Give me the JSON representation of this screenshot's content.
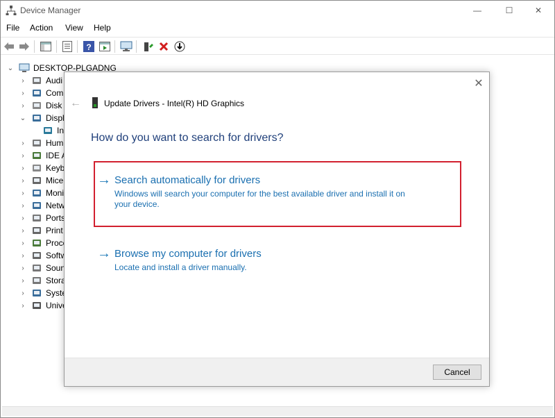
{
  "window": {
    "title": "Device Manager",
    "controls": {
      "minimize": "—",
      "maximize": "☐",
      "close": "✕"
    }
  },
  "menu": [
    "File",
    "Action",
    "View",
    "Help"
  ],
  "tree": {
    "root": "DESKTOP-PLGADNG",
    "items": [
      {
        "label": "Audi",
        "icon": "audio-icon",
        "expanded": false
      },
      {
        "label": "Com",
        "icon": "computer-icon",
        "expanded": false
      },
      {
        "label": "Disk d",
        "icon": "disk-icon",
        "expanded": false
      },
      {
        "label": "Displ",
        "icon": "display-icon",
        "expanded": true
      },
      {
        "label": "In",
        "icon": "display-adapter-icon",
        "child": true
      },
      {
        "label": "Hum",
        "icon": "hid-icon",
        "expanded": false
      },
      {
        "label": "IDE A",
        "icon": "ide-icon",
        "expanded": false
      },
      {
        "label": "Keyb",
        "icon": "keyboard-icon",
        "expanded": false
      },
      {
        "label": "Mice",
        "icon": "mouse-icon",
        "expanded": false
      },
      {
        "label": "Moni",
        "icon": "monitor-icon",
        "expanded": false
      },
      {
        "label": "Netw",
        "icon": "network-icon",
        "expanded": false
      },
      {
        "label": "Ports",
        "icon": "ports-icon",
        "expanded": false
      },
      {
        "label": "Print",
        "icon": "printer-icon",
        "expanded": false
      },
      {
        "label": "Proce",
        "icon": "processor-icon",
        "expanded": false
      },
      {
        "label": "Softw",
        "icon": "software-icon",
        "expanded": false
      },
      {
        "label": "Soun",
        "icon": "sound-icon",
        "expanded": false
      },
      {
        "label": "Stora",
        "icon": "storage-icon",
        "expanded": false
      },
      {
        "label": "Syste",
        "icon": "system-icon",
        "expanded": false
      },
      {
        "label": "Unive",
        "icon": "usb-icon",
        "expanded": false
      }
    ]
  },
  "dialog": {
    "header": "Update Drivers - Intel(R) HD Graphics",
    "question": "How do you want to search for drivers?",
    "options": [
      {
        "title": "Search automatically for drivers",
        "description": "Windows will search your computer for the best available driver and install it on your device."
      },
      {
        "title": "Browse my computer for drivers",
        "description": "Locate and install a driver manually."
      }
    ],
    "cancel_label": "Cancel",
    "close_glyph": "✕",
    "back_glyph": "←",
    "arrow_glyph": "→"
  },
  "colors": {
    "link_blue": "#1a6fb0",
    "heading_blue": "#1f3f7a",
    "highlight_red": "#d2202f"
  }
}
